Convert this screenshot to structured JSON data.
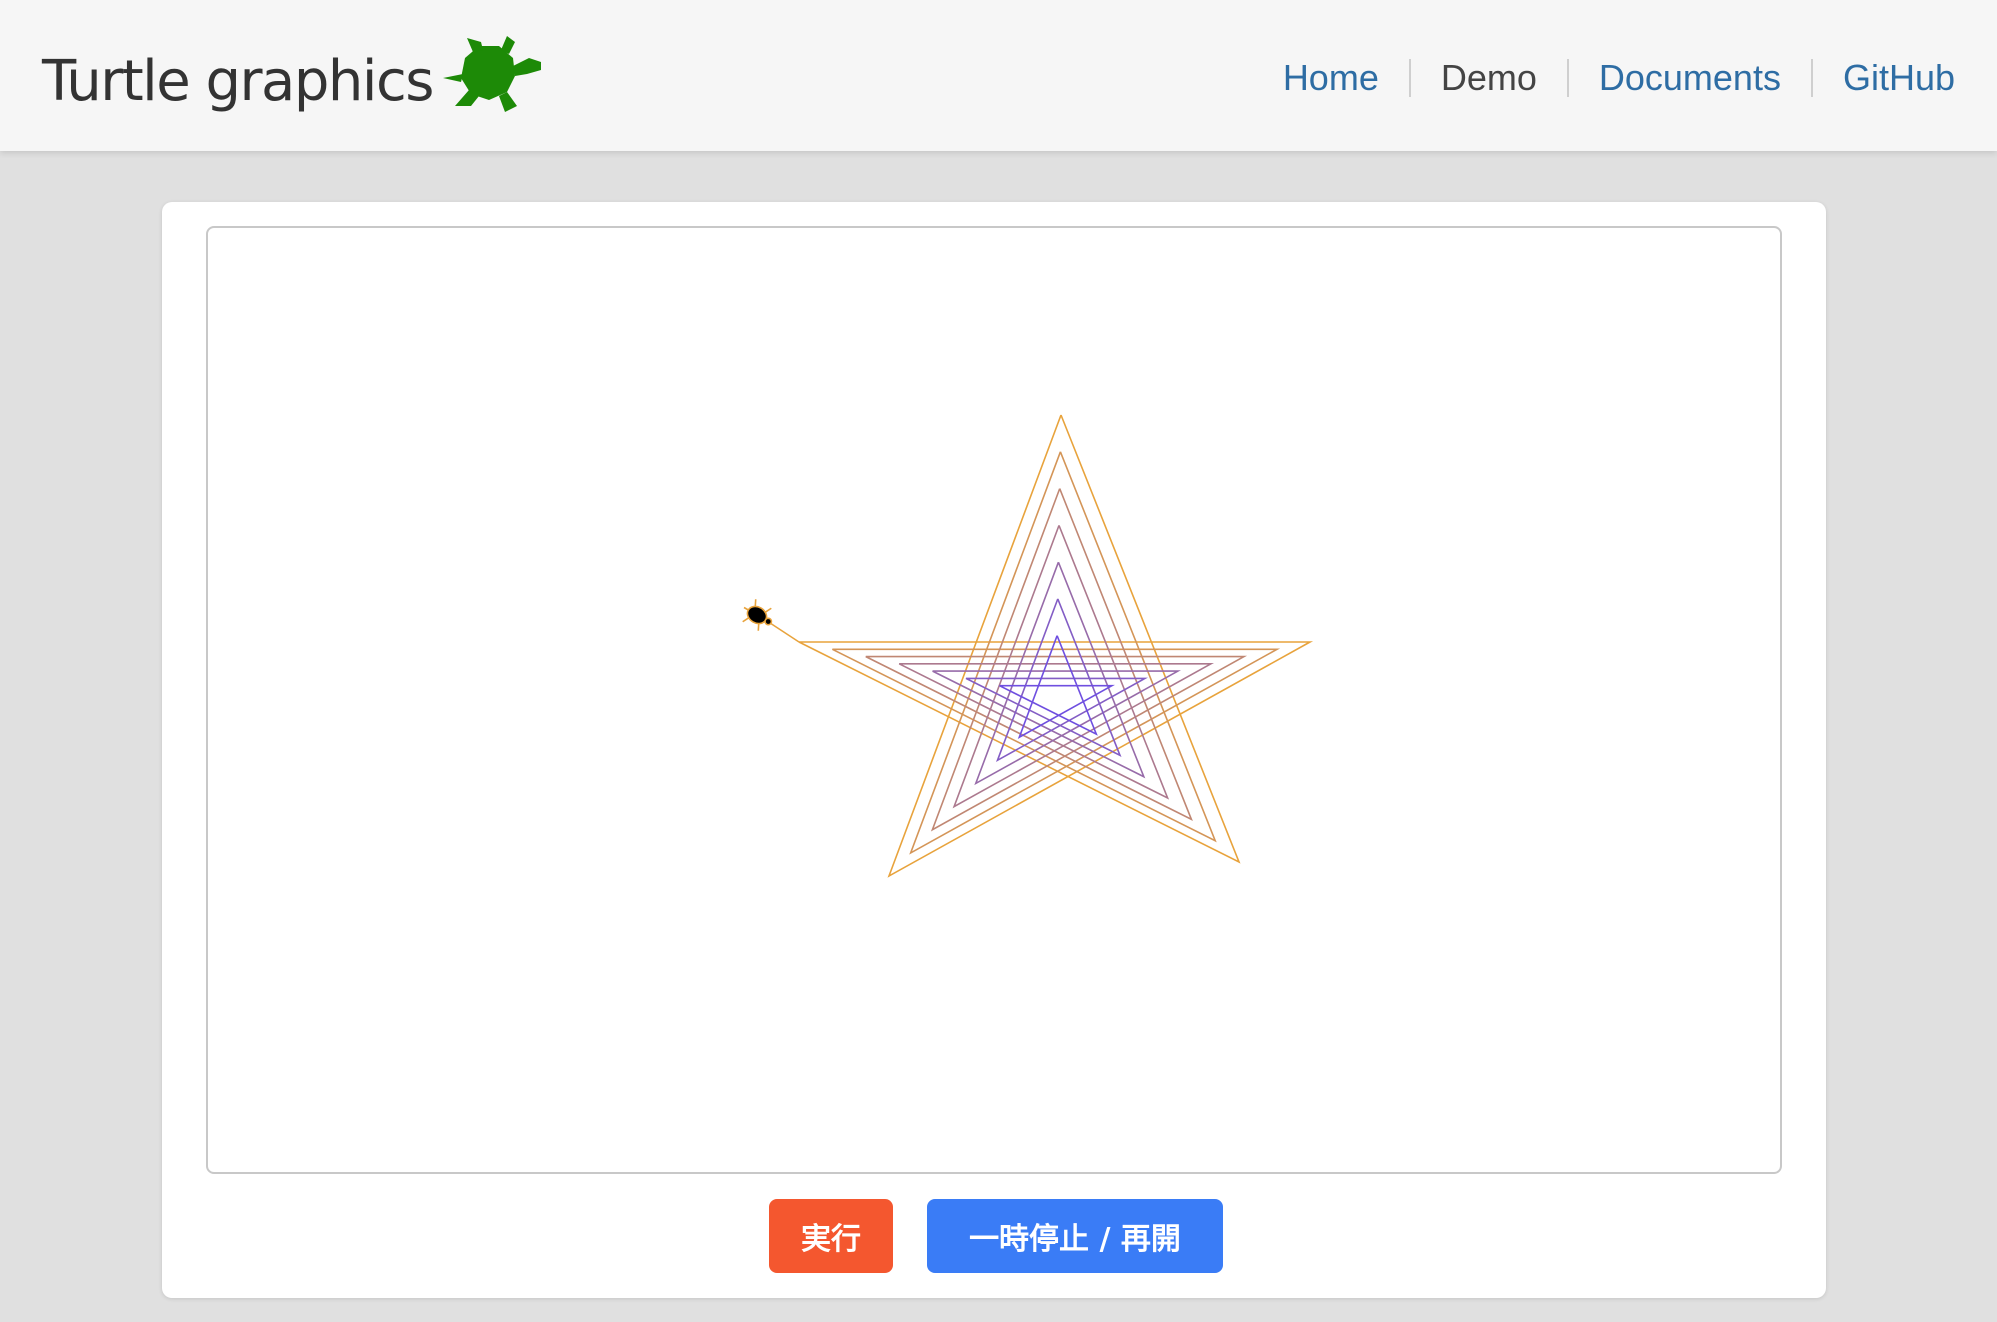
{
  "header": {
    "title": "Turtle graphics",
    "logo_icon": "turtle-icon",
    "logo_color": "#1d8a07",
    "nav": [
      {
        "label": "Home",
        "current": false
      },
      {
        "label": "Demo",
        "current": true
      },
      {
        "label": "Documents",
        "current": false
      },
      {
        "label": "GitHub",
        "current": false
      }
    ]
  },
  "drawing": {
    "shape": "nested five-pointed stars",
    "star_count": 7,
    "color_outer": "#e8a33c",
    "color_inner": "#6f4fe0",
    "turtle_icon": "turtle-cursor-icon",
    "turtle_color": "#000000",
    "turtle_outline": "#e8a33c"
  },
  "controls": {
    "run_label": "実行",
    "pause_label": "一時停止 / 再開",
    "run_color": "#f4572f",
    "pause_color": "#3a7cf6"
  }
}
